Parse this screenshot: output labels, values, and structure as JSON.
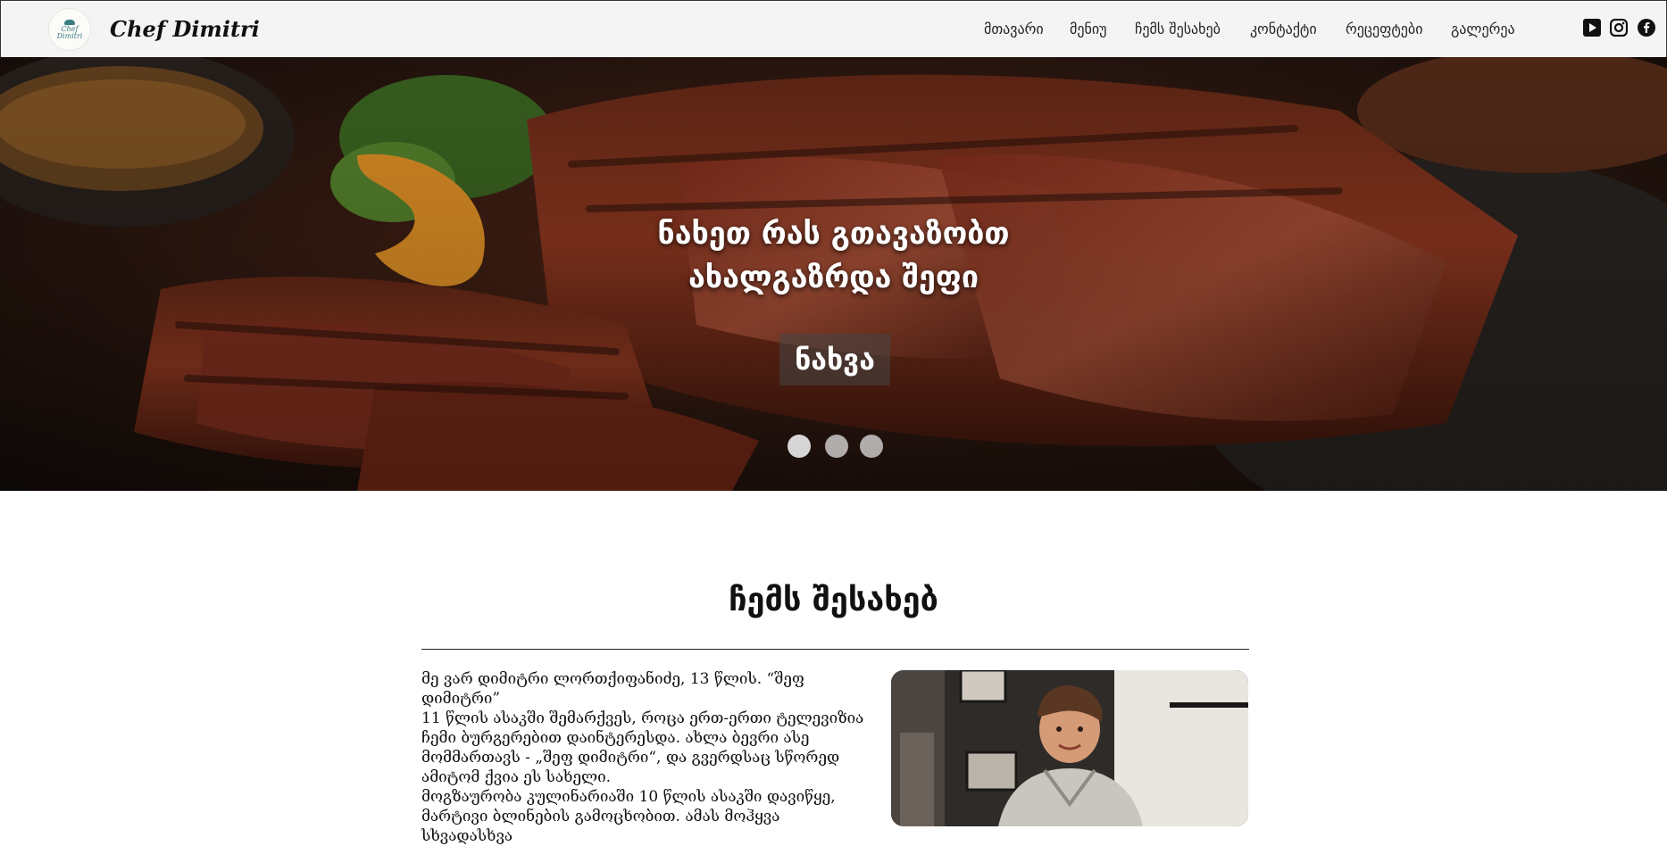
{
  "brand": {
    "name": "Chef Dimitri",
    "logo_text_top": "Chef",
    "logo_text_bottom": "Dimitri"
  },
  "nav": {
    "items": [
      {
        "label": "მთავარი"
      },
      {
        "label": "მენიუ"
      },
      {
        "label": "ჩემს შესახებ"
      },
      {
        "label": "კონტაქტი"
      },
      {
        "label": "რეცეფტები"
      },
      {
        "label": "გალერეა"
      }
    ],
    "social_icons": [
      "youtube-icon",
      "instagram-icon",
      "facebook-icon"
    ]
  },
  "hero": {
    "title_line1": "ნახეთ რას გთავაზობთ",
    "title_line2": "ახალგაზრდა შეფი",
    "button_label": "ნახვა",
    "slides_count": 3,
    "active_slide": 1
  },
  "about": {
    "title": "ჩემს შესახებ",
    "paragraph_lines": [
      "მე ვარ დიმიტრი ლორთქიფანიძე, 13 წლის. “შეფ დიმიტრი”",
      "11 წლის ასაკში შემარქვეს, როცა ერთ-ერთი ტელევიზია",
      "ჩემი ბურგერებით დაინტერესდა. ახლა ბევრი ასე",
      "მომმართავს - „შეფ დიმიტრი“, და გვერდსაც სწორედ",
      "ამიტომ ქვია ეს სახელი.",
      "მოგზაურობა კულინარიაში 10 წლის ასაკში დავიწყე,",
      "მარტივი ბლინების გამოცხობით. ამას მოჰყვა სხვადასხვა"
    ]
  },
  "colors": {
    "navbar_bg": "#f4f4f4",
    "hero_overlay_button": "#464646",
    "text": "#111111",
    "logo_accent": "#3a7d80"
  }
}
